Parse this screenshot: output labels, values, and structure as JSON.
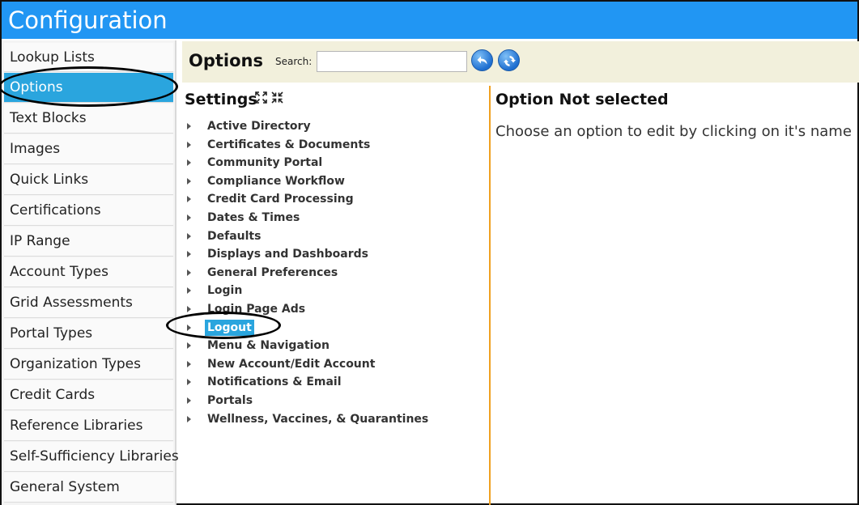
{
  "title_bar": {
    "title": "Configuration"
  },
  "sidebar": {
    "items": [
      {
        "label": "Lookup Lists",
        "active": false
      },
      {
        "label": "Options",
        "active": true
      },
      {
        "label": "Text Blocks",
        "active": false
      },
      {
        "label": "Images",
        "active": false
      },
      {
        "label": "Quick Links",
        "active": false
      },
      {
        "label": "Certifications",
        "active": false
      },
      {
        "label": "IP Range",
        "active": false
      },
      {
        "label": "Account Types",
        "active": false
      },
      {
        "label": "Grid Assessments",
        "active": false
      },
      {
        "label": "Portal Types",
        "active": false
      },
      {
        "label": "Organization Types",
        "active": false
      },
      {
        "label": "Credit Cards",
        "active": false
      },
      {
        "label": "Reference Libraries",
        "active": false
      },
      {
        "label": "Self-Sufficiency Libraries",
        "active": false
      },
      {
        "label": "General System",
        "active": false
      }
    ]
  },
  "header": {
    "title": "Options",
    "search_label": "Search:",
    "search_value": "",
    "buttons": [
      {
        "icon": "undo-arrow-icon"
      },
      {
        "icon": "refresh-icon"
      }
    ]
  },
  "settings": {
    "title": "Settings",
    "icons": [
      "expand-all-icon",
      "collapse-all-icon"
    ],
    "items": [
      {
        "label": "Active Directory",
        "selected": false
      },
      {
        "label": "Certificates & Documents",
        "selected": false
      },
      {
        "label": "Community Portal",
        "selected": false
      },
      {
        "label": "Compliance Workflow",
        "selected": false
      },
      {
        "label": "Credit Card Processing",
        "selected": false
      },
      {
        "label": "Dates & Times",
        "selected": false
      },
      {
        "label": "Defaults",
        "selected": false
      },
      {
        "label": "Displays and Dashboards",
        "selected": false
      },
      {
        "label": "General Preferences",
        "selected": false
      },
      {
        "label": "Login",
        "selected": false
      },
      {
        "label": "Login Page Ads",
        "selected": false
      },
      {
        "label": "Logout",
        "selected": true
      },
      {
        "label": "Menu & Navigation",
        "selected": false
      },
      {
        "label": "New Account/Edit Account",
        "selected": false
      },
      {
        "label": "Notifications & Email",
        "selected": false
      },
      {
        "label": "Portals",
        "selected": false
      },
      {
        "label": "Wellness, Vaccines, & Quarantines",
        "selected": false
      }
    ]
  },
  "detail": {
    "title": "Option Not selected",
    "message": "Choose an option to edit by clicking on it's name"
  },
  "colors": {
    "title_bar": "#2196f3",
    "active_highlight": "#2aa5de",
    "header_bg": "#f2f0dc",
    "divider": "#f0a020"
  }
}
